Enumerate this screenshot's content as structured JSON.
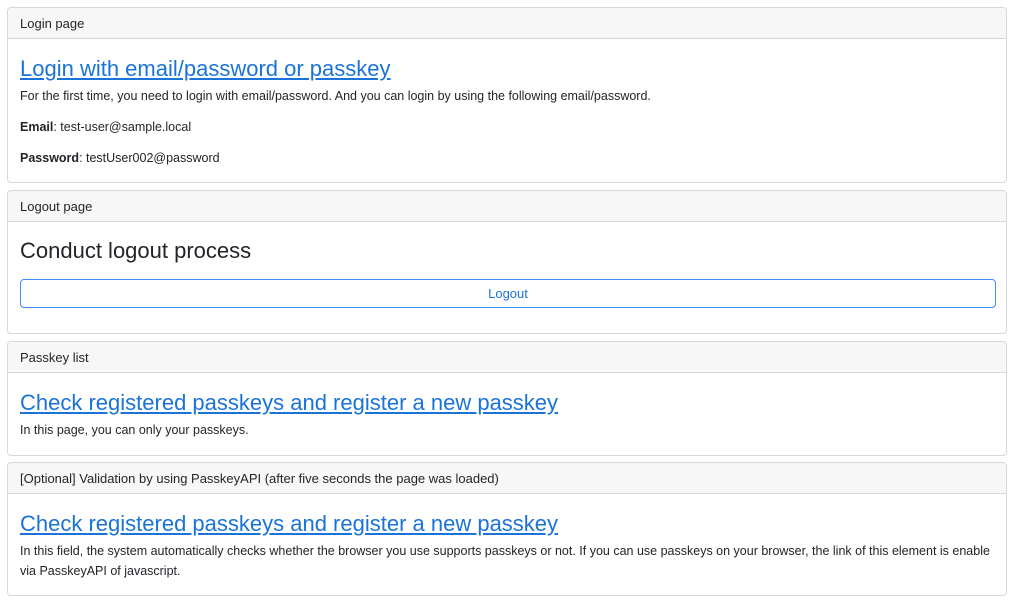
{
  "login_card": {
    "header": "Login page",
    "title_link": "Login with email/password or passkey",
    "description": "For the first time, you need to login with email/password. And you can login by using the following email/password.",
    "email_label": "Email",
    "email_value": ": test-user@sample.local",
    "password_label": "Password",
    "password_value": ": testUser002@password"
  },
  "logout_card": {
    "header": "Logout page",
    "title": "Conduct logout process",
    "button_label": "Logout"
  },
  "passkey_list_card": {
    "header": "Passkey list",
    "title_link": "Check registered passkeys and register a new passkey",
    "description": "In this page, you can only your passkeys."
  },
  "validation_card": {
    "header": "[Optional] Validation by using PasskeyAPI (after five seconds the page was loaded)",
    "title_link": "Check registered passkeys and register a new passkey",
    "description": "In this field, the system automatically checks whether the browser you use supports passkeys or not. If you can use passkeys on your browser, the link of this element is enable via PasskeyAPI of javascript."
  },
  "colors": {
    "link": "#1a73d9",
    "card_border": "#d6d8db",
    "header_bg": "#f7f7f7",
    "button_border": "#3d8bfd"
  }
}
